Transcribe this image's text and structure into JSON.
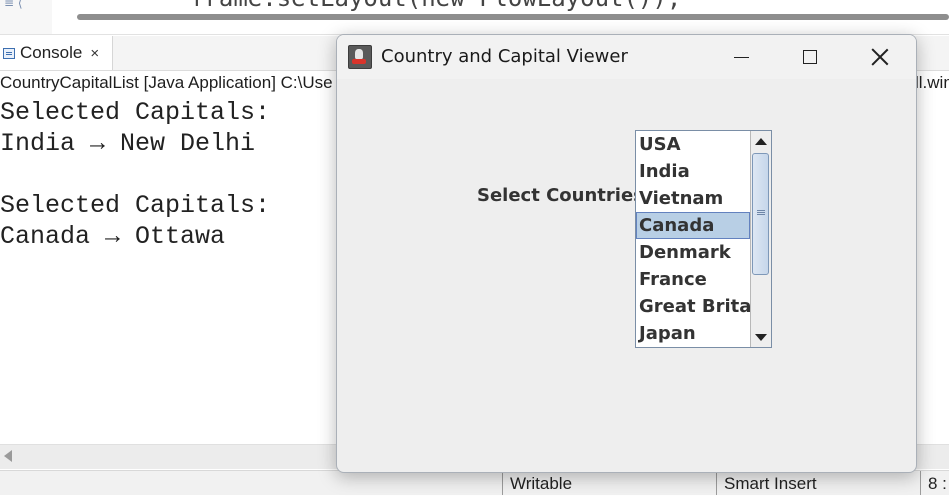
{
  "editor": {
    "code_fragment": "frame.setLayout(new FlowLayout());"
  },
  "console_view": {
    "tab_label": "Console",
    "close_glyph": "×",
    "launch_description": "CountryCapitalList [Java Application] C:\\Use",
    "launch_description_tail": "ll.win",
    "output_lines": [
      "Selected Capitals:",
      "India → New Delhi",
      "",
      "Selected Capitals:",
      "Canada → Ottawa"
    ]
  },
  "statusbar": {
    "writable": "Writable",
    "insert_mode": "Smart Insert",
    "position": "8 :"
  },
  "window": {
    "title": "Country and Capital Viewer",
    "select_label": "Select Countries:",
    "countries": [
      "USA",
      "India",
      "Vietnam",
      "Canada",
      "Denmark",
      "France",
      "Great Britain",
      "Japan"
    ],
    "selected_country": "Canada",
    "colors": {
      "selection_bg": "#b8cfe5",
      "selection_border": "#6382bf",
      "window_bg": "#eeeeee"
    }
  }
}
